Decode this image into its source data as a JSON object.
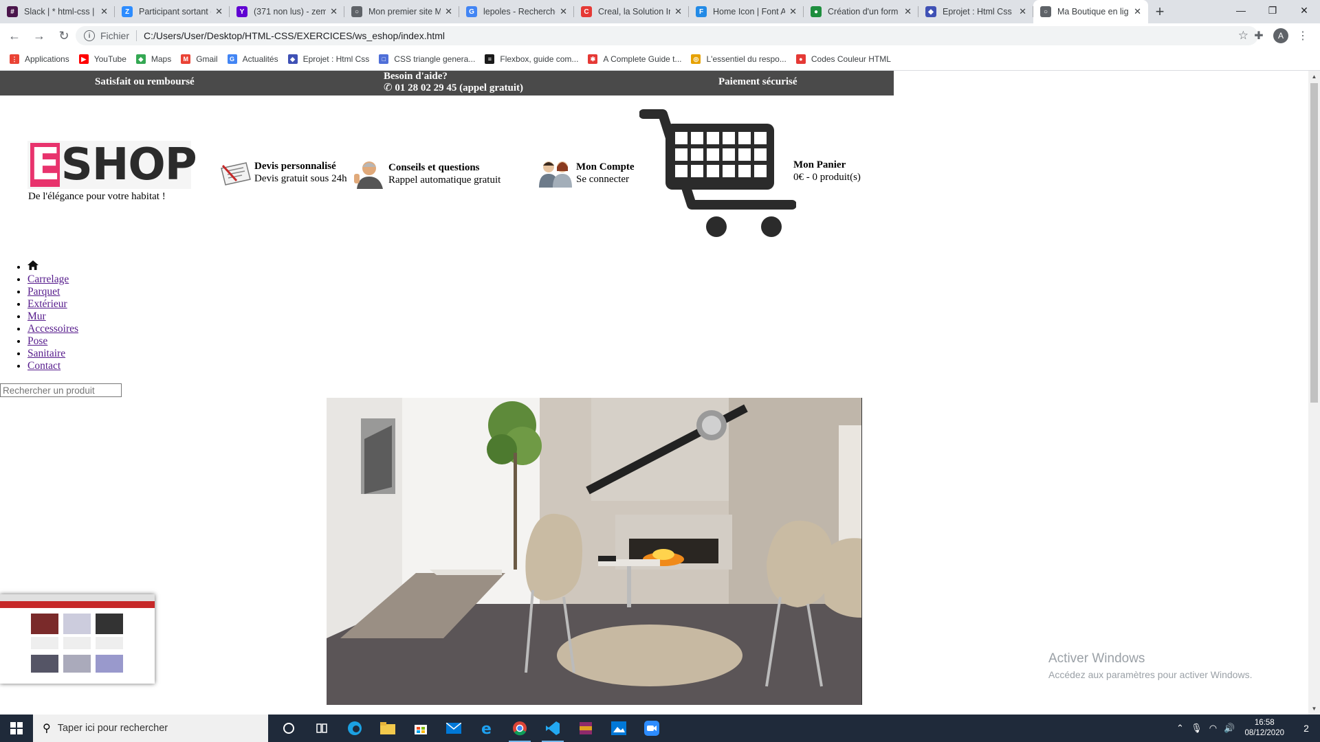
{
  "browser": {
    "tabs": [
      {
        "label": "Slack | * html-css | V",
        "favicon_color": "#4a154b",
        "favicon_char": "#"
      },
      {
        "label": "Participant sortant c",
        "favicon_color": "#2d8cff",
        "favicon_char": "Z"
      },
      {
        "label": "(371 non lus) - zem",
        "favicon_color": "#6001d2",
        "favicon_char": "Y"
      },
      {
        "label": "Mon premier site M",
        "favicon_color": "#5f6368",
        "favicon_char": "○"
      },
      {
        "label": "lepoles - Recherche",
        "favicon_color": "#4285f4",
        "favicon_char": "G"
      },
      {
        "label": "Creal, la Solution In",
        "favicon_color": "#e53935",
        "favicon_char": "C"
      },
      {
        "label": "Home Icon | Font A",
        "favicon_color": "#228ae6",
        "favicon_char": "F"
      },
      {
        "label": "Création d'un form",
        "favicon_color": "#1e8e3e",
        "favicon_char": "●"
      },
      {
        "label": "Eprojet : Html Css",
        "favicon_color": "#3f51b5",
        "favicon_char": "◆"
      },
      {
        "label": "Ma Boutique en lig",
        "favicon_color": "#5f6368",
        "favicon_char": "○",
        "active": true
      }
    ],
    "url_scheme": "Fichier",
    "url": "C:/Users/User/Desktop/HTML-CSS/EXERCICES/ws_eshop/index.html",
    "profile_initial": "A",
    "bookmarks": [
      {
        "label": "Applications",
        "color": "#ea4335",
        "char": "⋮"
      },
      {
        "label": "YouTube",
        "color": "#ff0000",
        "char": "▶"
      },
      {
        "label": "Maps",
        "color": "#34a853",
        "char": "◆"
      },
      {
        "label": "Gmail",
        "color": "#ea4335",
        "char": "M"
      },
      {
        "label": "Actualités",
        "color": "#4285f4",
        "char": "G"
      },
      {
        "label": "Eprojet : Html Css",
        "color": "#3f51b5",
        "char": "◆"
      },
      {
        "label": "CSS triangle genera...",
        "color": "#4f6fd8",
        "char": "□"
      },
      {
        "label": "Flexbox, guide com...",
        "color": "#1a1a1a",
        "char": "≡"
      },
      {
        "label": "A Complete Guide t...",
        "color": "#e53935",
        "char": "✱"
      },
      {
        "label": "L'essentiel du respo...",
        "color": "#e6a100",
        "char": "◎"
      },
      {
        "label": "Codes Couleur HTML",
        "color": "#e53935",
        "char": "●"
      }
    ]
  },
  "page": {
    "topbar": {
      "left": "Satisfait ou remboursé",
      "help_title": "Besoin d'aide?",
      "help_phone": "01 28 02 29 45 (appel gratuit)",
      "right": "Paiement sécurisé"
    },
    "logo": {
      "letter": "E",
      "rest": "SHOP",
      "accent": "#e8336d"
    },
    "slogan": "De l'élégance pour votre habitat !",
    "features": {
      "quote": {
        "title": "Devis personnalisé",
        "sub": "Devis gratuit sous 24h"
      },
      "advice": {
        "title": "Conseils et questions",
        "sub": "Rappel automatique gratuit"
      },
      "account": {
        "title": "Mon Compte",
        "sub": "Se connecter"
      },
      "cart": {
        "title": "Mon Panier",
        "sub": "0€ - 0 produit(s)"
      }
    },
    "menu": [
      "Carrelage",
      "Parquet",
      "Extérieur",
      "Mur",
      "Accessoires",
      "Pose",
      "Sanitaire",
      "Contact"
    ],
    "search_placeholder": "Rechercher un produit"
  },
  "watermark": {
    "title": "Activer Windows",
    "subtitle": "Accédez aux paramètres pour activer Windows."
  },
  "taskbar": {
    "search_placeholder": "Taper ici pour rechercher",
    "time": "16:58",
    "date": "08/12/2020",
    "notifications": "2"
  }
}
